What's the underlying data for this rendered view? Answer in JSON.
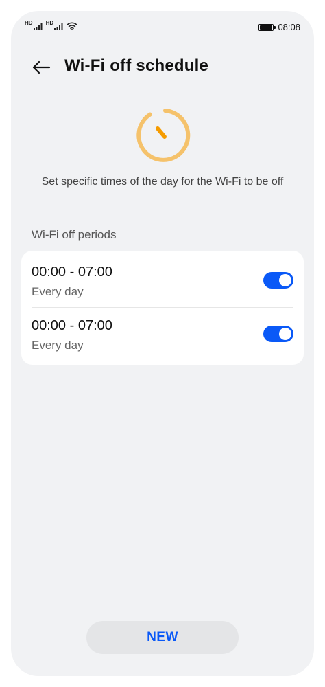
{
  "status_bar": {
    "signal_1_label": "HD",
    "signal_2_label": "HD",
    "time": "08:08"
  },
  "header": {
    "title": "Wi-Fi off schedule"
  },
  "hero": {
    "icon": "timer-icon",
    "description": "Set specific times of the day for the Wi-Fi to be off"
  },
  "periods": {
    "section_title": "Wi-Fi off periods",
    "items": [
      {
        "time": "00:00 - 07:00",
        "repeat": "Every day",
        "enabled": true
      },
      {
        "time": "00:00 - 07:00",
        "repeat": "Every day",
        "enabled": true
      }
    ]
  },
  "actions": {
    "new_label": "NEW"
  },
  "colors": {
    "accent": "#0a59f7",
    "timer_ring": "#f5c26b",
    "timer_hand": "#f59b00",
    "background": "#f1f2f4"
  }
}
